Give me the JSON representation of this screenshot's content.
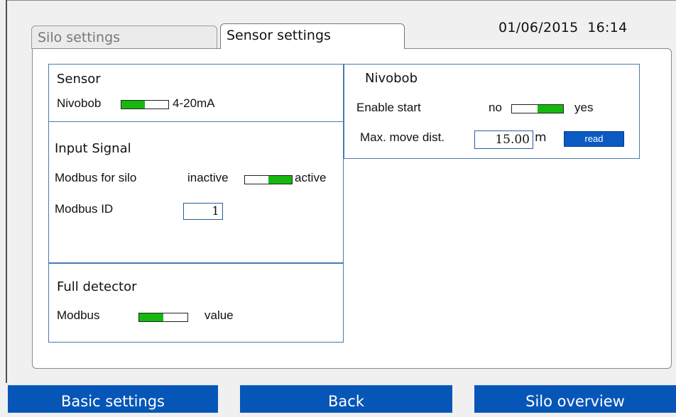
{
  "tabs": [
    {
      "label": "Silo settings",
      "active": false
    },
    {
      "label": "Sensor settings",
      "active": true
    }
  ],
  "header": {
    "date": "01/06/2015",
    "time": "16:14"
  },
  "sensor": {
    "title": "Sensor",
    "left_label": "Nivobob",
    "right_label": "4-20mA",
    "selected": "Nivobob"
  },
  "input_signal": {
    "title": "Input Signal",
    "modbus_label": "Modbus for silo",
    "off_label": "inactive",
    "on_label": "active",
    "state": "active",
    "id_label": "Modbus ID",
    "id_value": "1"
  },
  "full_detector": {
    "title": "Full detector",
    "left_label": "Modbus",
    "right_label": "value",
    "selected": "Modbus"
  },
  "nivobob": {
    "title": "Nivobob",
    "enable_label": "Enable start",
    "no_label": "no",
    "yes_label": "yes",
    "state": "yes",
    "max_label": "Max. move dist.",
    "max_value": "15.00",
    "unit": "m",
    "read_label": "read"
  },
  "bottom_buttons": {
    "basic": "Basic settings",
    "back": "Back",
    "overview": "Silo overview"
  },
  "colors": {
    "toggle_on": "#16b80f",
    "button_blue": "#0656b8",
    "box_border": "#4a7ab0"
  }
}
